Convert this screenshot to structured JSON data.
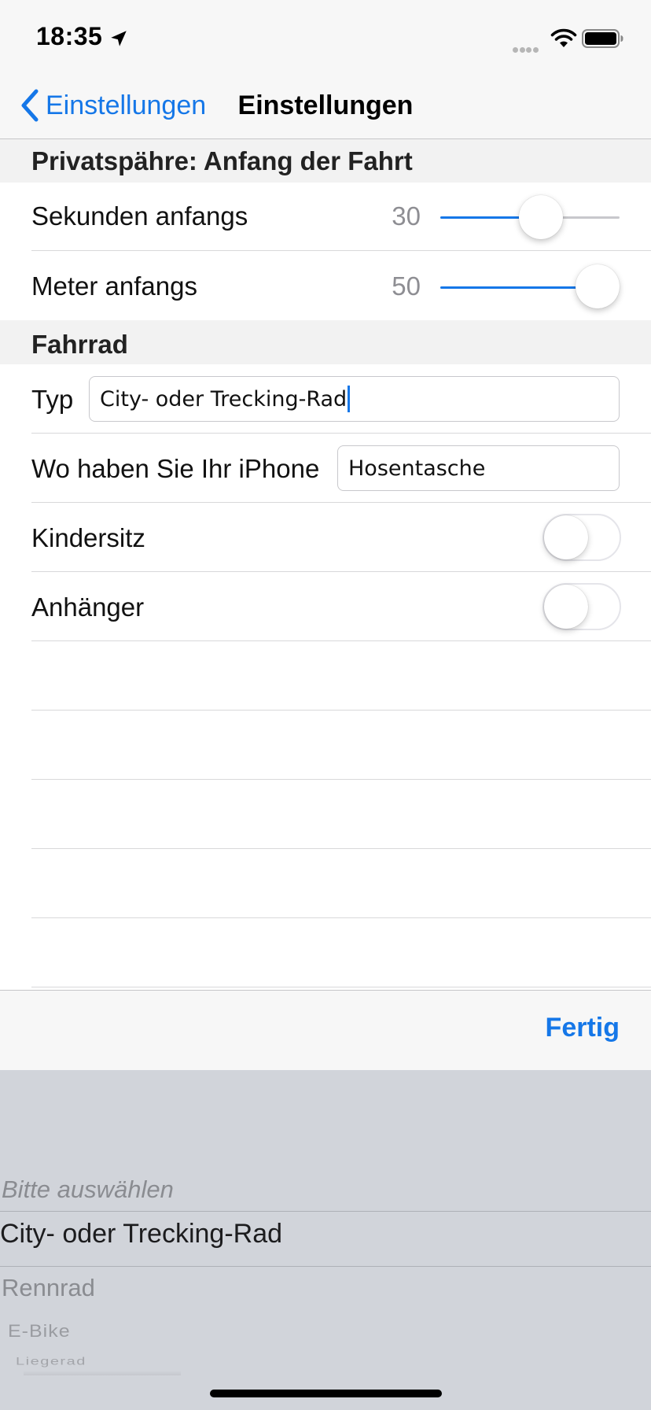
{
  "status_bar": {
    "time": "18:35"
  },
  "nav": {
    "back_label": "Einstellungen",
    "title": "Einstellungen"
  },
  "sections": {
    "privacy": {
      "header": "Privatspähre: Anfang der Fahrt",
      "seconds": {
        "label": "Sekunden anfangs",
        "value": "30",
        "fraction": 0.58
      },
      "meters": {
        "label": "Meter anfangs",
        "value": "50",
        "fraction": 1.0
      }
    },
    "bike": {
      "header": "Fahrrad",
      "type": {
        "label": "Typ",
        "value": "City- oder Trecking-Rad"
      },
      "phone": {
        "label": "Wo haben Sie Ihr iPhone",
        "value": "Hosentasche"
      },
      "child_seat": {
        "label": "Kindersitz",
        "on": false
      },
      "trailer": {
        "label": "Anhänger",
        "on": false
      }
    }
  },
  "accessory": {
    "done_label": "Fertig"
  },
  "picker": {
    "items": [
      "Bitte auswählen",
      "City- oder Trecking-Rad",
      "Rennrad",
      "E-Bike",
      "Liegerad"
    ],
    "selected_index": 1
  },
  "colors": {
    "accent": "#1577e8",
    "picker_bg": "#d1d4da",
    "bar_bg": "#f7f7f7"
  }
}
